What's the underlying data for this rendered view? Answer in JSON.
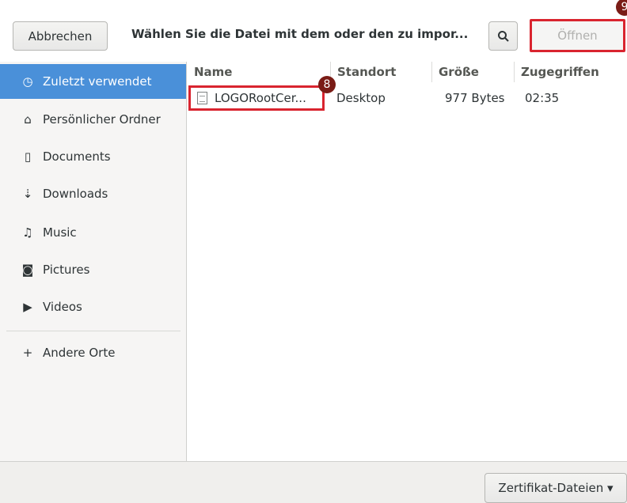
{
  "header": {
    "cancel_label": "Abbrechen",
    "title": "Wählen Sie die Datei mit dem oder den zu impor...",
    "search_icon": "search-icon",
    "open_label": "Öffnen",
    "badge_open": "9"
  },
  "sidebar": {
    "items": [
      {
        "label": "Zuletzt verwendet",
        "icon": "clock-icon",
        "glyph": "◷",
        "active": true
      },
      {
        "label": "Persönlicher Ordner",
        "icon": "home-icon",
        "glyph": "⌂"
      },
      {
        "label": "Documents",
        "icon": "document-icon",
        "glyph": "▯"
      },
      {
        "label": "Downloads",
        "icon": "download-icon",
        "glyph": "⇣"
      },
      {
        "label": "Music",
        "icon": "music-icon",
        "glyph": "♫"
      },
      {
        "label": "Pictures",
        "icon": "camera-icon",
        "glyph": "◙"
      },
      {
        "label": "Videos",
        "icon": "video-icon",
        "glyph": "▶"
      },
      {
        "label": "Andere Orte",
        "icon": "plus-icon",
        "glyph": "+"
      }
    ]
  },
  "filelist": {
    "columns": [
      "Name",
      "Standort",
      "Größe",
      "Zugegriffen"
    ],
    "rows": [
      {
        "name": "LOGORootCer...",
        "location": "Desktop",
        "size": "977 Bytes",
        "accessed": "02:35"
      }
    ],
    "badge_row": "8"
  },
  "footer": {
    "filter_label": "Zertifikat-Dateien ▾"
  },
  "colors": {
    "accent": "#4a90d9",
    "highlight_border": "#d9242f",
    "badge": "#7a1c16"
  }
}
